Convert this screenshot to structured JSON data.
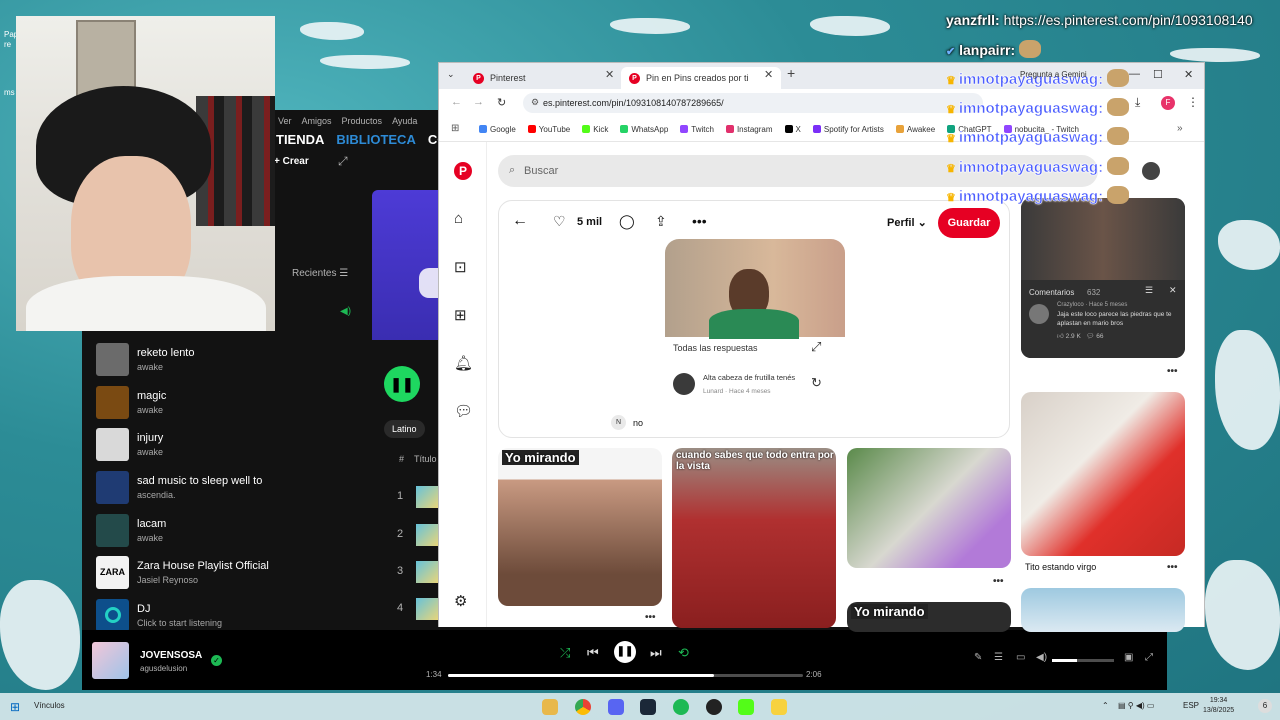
{
  "desktop": {
    "icon_labels": [
      "Pap",
      "re",
      "ms"
    ]
  },
  "spotify": {
    "menu": [
      "Ver",
      "Amigos",
      "Productos",
      "Ayuda"
    ],
    "nav": [
      "TIENDA",
      "BIBLIOTECA",
      "COM"
    ],
    "crear_label": "Crear",
    "recientes_label": "Recientes",
    "library": [
      {
        "title": "reketo lento",
        "subtitle": "awake",
        "color": "#6b6b6b"
      },
      {
        "title": "magic",
        "subtitle": "awake",
        "color": "#7a4a12"
      },
      {
        "title": "injury",
        "subtitle": "awake",
        "color": "#d9d9d9"
      },
      {
        "title": "sad music to sleep well to",
        "subtitle": "ascendia.",
        "color": "#1f3b73"
      },
      {
        "title": "lacam",
        "subtitle": "awake",
        "color": "#234a4a"
      },
      {
        "title": "Zara House Playlist Official",
        "subtitle": "Jasiel Reynoso",
        "color": "#f2f2f2"
      },
      {
        "title": "DJ",
        "subtitle": "Click to start listening",
        "color": "#0d4f8b"
      }
    ],
    "chip_label": "Latino",
    "track_header": {
      "num": "#",
      "title": "Título"
    },
    "tracks": [
      "1",
      "2",
      "3",
      "4"
    ],
    "player": {
      "title": "JOVENSOSA",
      "artist": "agusdelusion",
      "time_elapsed": "1:34",
      "time_total": "2:06",
      "progress": 0.75,
      "volume": 0.4
    }
  },
  "browser": {
    "tabs": [
      {
        "label": "Pinterest"
      },
      {
        "label": "Pin en Pins creados por ti"
      }
    ],
    "url": "es.pinterest.com/pin/1093108140787289665/",
    "bookmarks": [
      "Google",
      "YouTube",
      "Kick",
      "WhatsApp",
      "Twitch",
      "Instagram",
      "X",
      "Spotify for Artists",
      "Awakee",
      "ChatGPT",
      "nobucita_ - Twitch"
    ],
    "bookmark_colors": [
      "#4285f4",
      "#ff0000",
      "#53fc18",
      "#25d366",
      "#9146ff",
      "#e1306c",
      "#000000",
      "#7b2ff7",
      "#e8a23a",
      "#10a37f",
      "#9146ff"
    ],
    "profile_initial": "F"
  },
  "pinterest": {
    "search_placeholder": "Buscar",
    "likes": "5 mil",
    "profile_label": "Perfil",
    "save_label": "Guardar",
    "pin_media": {
      "responses_label": "Todas las respuestas",
      "comment_text": "Alta cabeza de frutilla tenés",
      "comment_user": "Lunard · Hace 4 meses"
    },
    "comment_initial": "N",
    "comment_text": "no",
    "tiles": [
      {
        "caption": "Yo mirando"
      },
      {
        "caption": "cuando sabes que todo entra por la vista"
      },
      {
        "caption": ""
      },
      {
        "caption": "Yo mirando"
      }
    ],
    "side_card": {
      "comments_title": "Comentarios",
      "comments_count": "632",
      "comment_text": "Jaja este loco parece las piedras que te aplastan en mario bros",
      "comment_user": "Crazyloco · Hace 5 meses",
      "likes": "2.9 K",
      "replies": "66"
    },
    "side_label": "Tito estando virgo"
  },
  "chat": {
    "line1_user": "yanzfrll:",
    "line1_text": "https://es.pinterest.com/pin/1093108140",
    "line2_user": "lanpairr:",
    "repeated_user": "imnotpayaguaswag:",
    "gemini_label": "Pregunta a Gemini"
  },
  "taskbar": {
    "left_label": "Vínculos",
    "lang": "ESP",
    "time": "19:34",
    "date": "13/8/2025"
  }
}
